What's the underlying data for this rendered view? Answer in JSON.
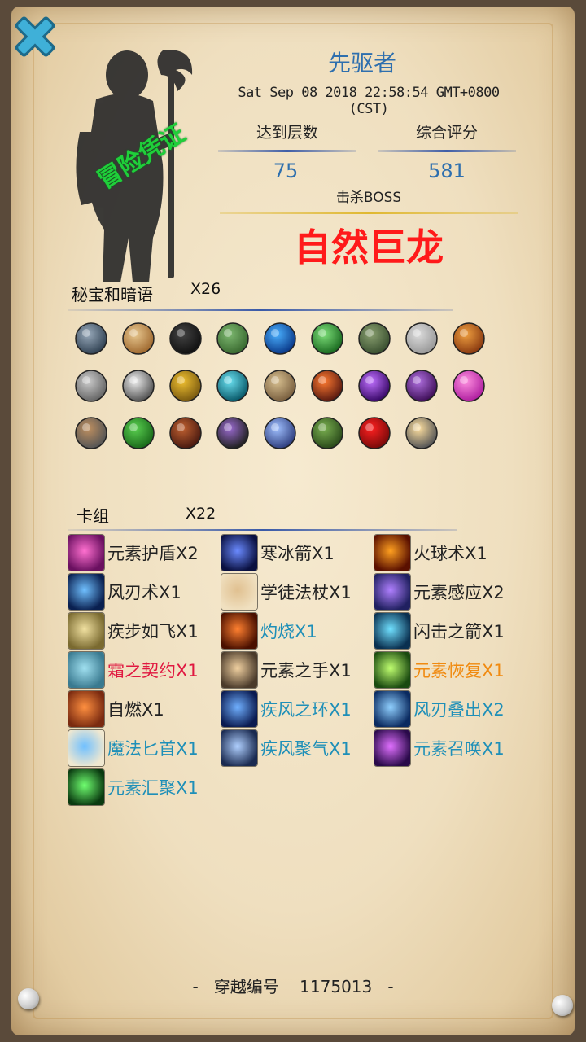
{
  "header": {
    "hero_name": "先驱者",
    "timestamp": "Sat Sep 08 2018 22:58:54 GMT+0800 (CST)",
    "stamp_text": "冒险凭证",
    "stats": [
      {
        "label": "达到层数",
        "value": "75"
      },
      {
        "label": "综合评分",
        "value": "581"
      }
    ],
    "boss_label": "击杀BOSS",
    "boss_name": "自然巨龙"
  },
  "treasures": {
    "title": "秘宝和暗语",
    "count": "X26",
    "items": [
      {
        "icon": "armor-icon",
        "c1": "#9ab",
        "c2": "#345"
      },
      {
        "icon": "scroll-icon",
        "c1": "#e8c890",
        "c2": "#a06a30"
      },
      {
        "icon": "triquetra-icon",
        "c1": "#444",
        "c2": "#111"
      },
      {
        "icon": "map-icon",
        "c1": "#7db870",
        "c2": "#3a6a30"
      },
      {
        "icon": "blue-rune-icon",
        "c1": "#4ab0ff",
        "c2": "#0a3a8a"
      },
      {
        "icon": "green-rune-icon",
        "c1": "#7ee07a",
        "c2": "#1a6a20"
      },
      {
        "icon": "turtle-shell-icon",
        "c1": "#8aa070",
        "c2": "#3a5030"
      },
      {
        "icon": "vial-icon",
        "c1": "#ddd",
        "c2": "#999"
      },
      {
        "icon": "fire-barrel-icon",
        "c1": "#f0a040",
        "c2": "#8a3a10"
      },
      {
        "icon": "gauntlet-icon",
        "c1": "#ccc",
        "c2": "#666"
      },
      {
        "icon": "crescent-blade-icon",
        "c1": "#eee",
        "c2": "#555"
      },
      {
        "icon": "medal-icon",
        "c1": "#f0c030",
        "c2": "#7a5a10"
      },
      {
        "icon": "cyan-rune-icon",
        "c1": "#6ae0f0",
        "c2": "#0a5a6a"
      },
      {
        "icon": "ancient-scroll-icon",
        "c1": "#d8c090",
        "c2": "#7a6040"
      },
      {
        "icon": "flame-seed-icon",
        "c1": "#ff7a30",
        "c2": "#5a1a10"
      },
      {
        "icon": "purple-rune-icon",
        "c1": "#c070ff",
        "c2": "#3a0a6a"
      },
      {
        "icon": "magic-wand-icon",
        "c1": "#b070e0",
        "c2": "#40105a"
      },
      {
        "icon": "gift-box-icon",
        "c1": "#ff90e0",
        "c2": "#b020a0"
      },
      {
        "icon": "hammer-icon",
        "c1": "#c09060",
        "c2": "#555"
      },
      {
        "icon": "clover-icon",
        "c1": "#5ad050",
        "c2": "#1a6a1a"
      },
      {
        "icon": "fire-pouch-icon",
        "c1": "#c06030",
        "c2": "#4a1a10"
      },
      {
        "icon": "amethyst-ring-icon",
        "c1": "#9a6ad0",
        "c2": "#222"
      },
      {
        "icon": "crystal-orb-icon",
        "c1": "#a0c0ff",
        "c2": "#304080"
      },
      {
        "icon": "spellbook-icon",
        "c1": "#7ab050",
        "c2": "#2a4a1a"
      },
      {
        "icon": "rose-icon",
        "c1": "#ff2020",
        "c2": "#7a0a0a"
      },
      {
        "icon": "lantern-icon",
        "c1": "#ffe0a0",
        "c2": "#555"
      }
    ]
  },
  "deck": {
    "title": "卡组",
    "count": "X22",
    "cards": [
      {
        "label": "元素护盾X2",
        "color": "black",
        "c1": "#ff70d0",
        "c2": "#6a1060"
      },
      {
        "label": "寒冰箭X1",
        "color": "black",
        "c1": "#6a8aff",
        "c2": "#0a1040"
      },
      {
        "label": "火球术X1",
        "color": "black",
        "c1": "#ffa020",
        "c2": "#5a1000"
      },
      {
        "label": "风刃术X1",
        "color": "black",
        "c1": "#70c0ff",
        "c2": "#0a2050"
      },
      {
        "label": "学徒法杖X1",
        "color": "black",
        "c1": "#e0c090",
        "c2": "#f0e0c0"
      },
      {
        "label": "元素感应X2",
        "color": "black",
        "c1": "#b080ff",
        "c2": "#202060"
      },
      {
        "label": "疾步如飞X1",
        "color": "black",
        "c1": "#f0e0a0",
        "c2": "#7a6a30"
      },
      {
        "label": "灼烧X1",
        "color": "blue",
        "c1": "#ff8030",
        "c2": "#4a1000"
      },
      {
        "label": "闪击之箭X1",
        "color": "black",
        "c1": "#70e0ff",
        "c2": "#0a3050"
      },
      {
        "label": "霜之契约X1",
        "color": "red",
        "c1": "#a0e0f0",
        "c2": "#3a7a90"
      },
      {
        "label": "元素之手X1",
        "color": "black",
        "c1": "#f0d0a0",
        "c2": "#4a3a2a"
      },
      {
        "label": "元素恢复X1",
        "color": "orange",
        "c1": "#c0ff70",
        "c2": "#1a4a10"
      },
      {
        "label": "自燃X1",
        "color": "black",
        "c1": "#ff9040",
        "c2": "#7a2a10"
      },
      {
        "label": "疾风之环X1",
        "color": "blue",
        "c1": "#70b0ff",
        "c2": "#0a1a50"
      },
      {
        "label": "风刃叠出X2",
        "color": "blue",
        "c1": "#90d0ff",
        "c2": "#0a2a60"
      },
      {
        "label": "魔法匕首X1",
        "color": "blue",
        "c1": "#70c0ff",
        "c2": "#f0e8d0"
      },
      {
        "label": "疾风聚气X1",
        "color": "blue",
        "c1": "#b0d0ff",
        "c2": "#1a2a50"
      },
      {
        "label": "元素召唤X1",
        "color": "blue",
        "c1": "#e070ff",
        "c2": "#2a0a4a"
      },
      {
        "label": "元素汇聚X1",
        "color": "blue",
        "c1": "#70ff70",
        "c2": "#0a3a10"
      }
    ]
  },
  "footer": {
    "label": "穿越编号",
    "number": "1175013",
    "dash_left": "-",
    "dash_right": "-"
  }
}
